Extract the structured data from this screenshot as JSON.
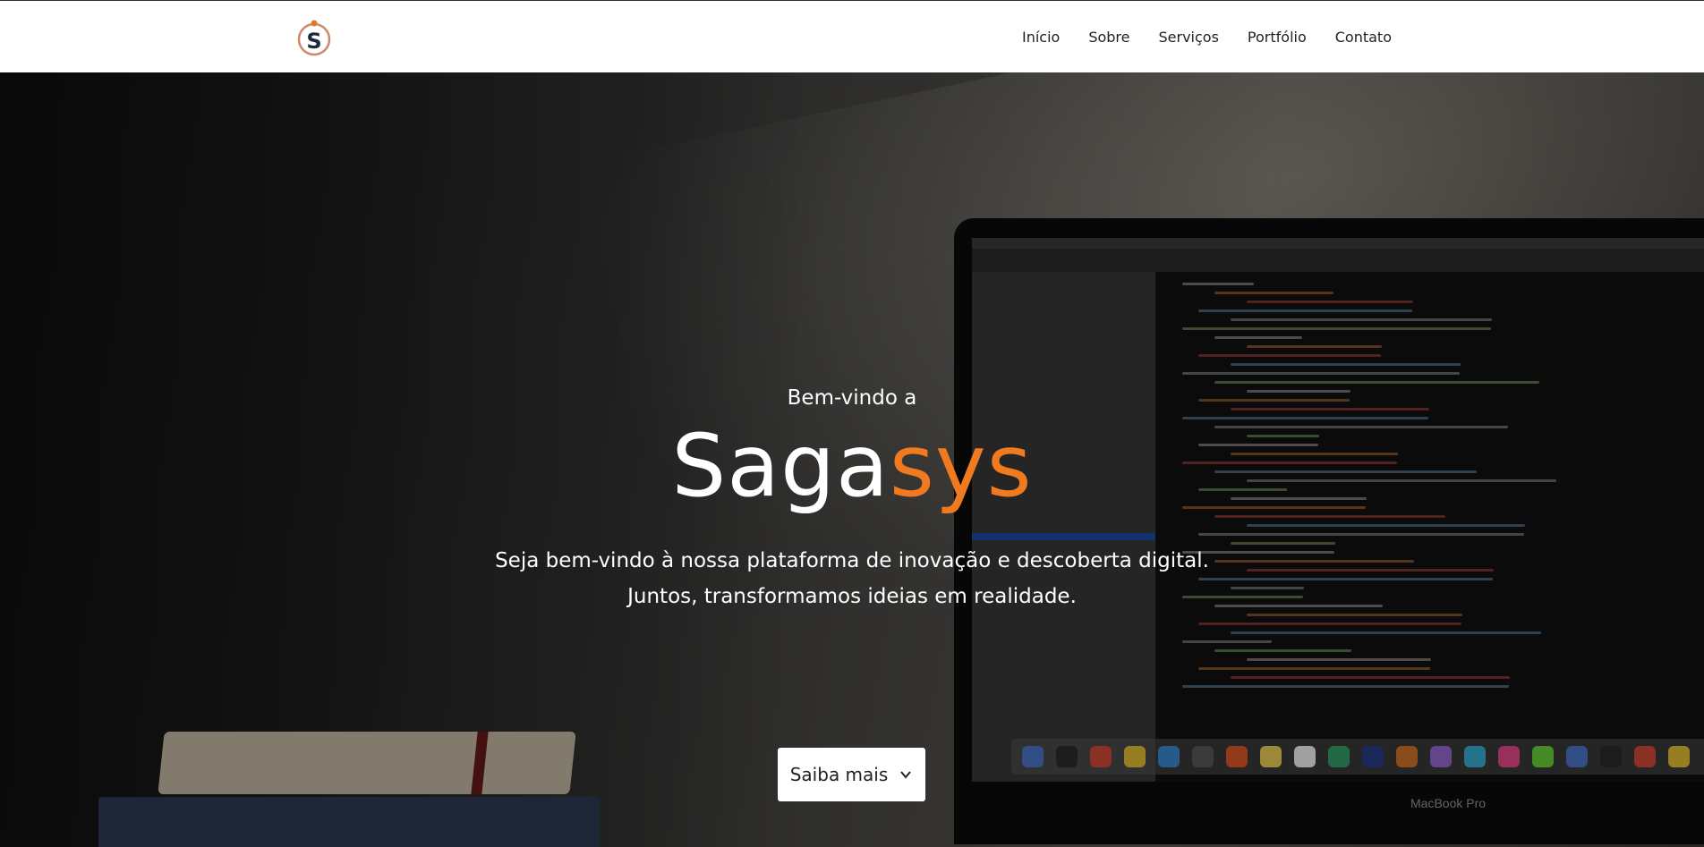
{
  "brand": {
    "logo_letter": "S",
    "colors": {
      "accent": "#f07a1f",
      "dark": "#1b2a3a"
    }
  },
  "nav": {
    "items": [
      {
        "label": "Início"
      },
      {
        "label": "Sobre"
      },
      {
        "label": "Serviços"
      },
      {
        "label": "Portfólio"
      },
      {
        "label": "Contato"
      }
    ]
  },
  "hero": {
    "welcome": "Bem-vindo a",
    "title_main": "Saga",
    "title_accent": "sys",
    "description_line1": "Seja bem-vindo à nossa plataforma de inovação e descoberta digital.",
    "description_line2": "Juntos, transformamos ideias em realidade.",
    "cta_label": "Saiba mais",
    "cta_icon": "chevron-down-icon",
    "laptop_brand": "MacBook Pro"
  }
}
